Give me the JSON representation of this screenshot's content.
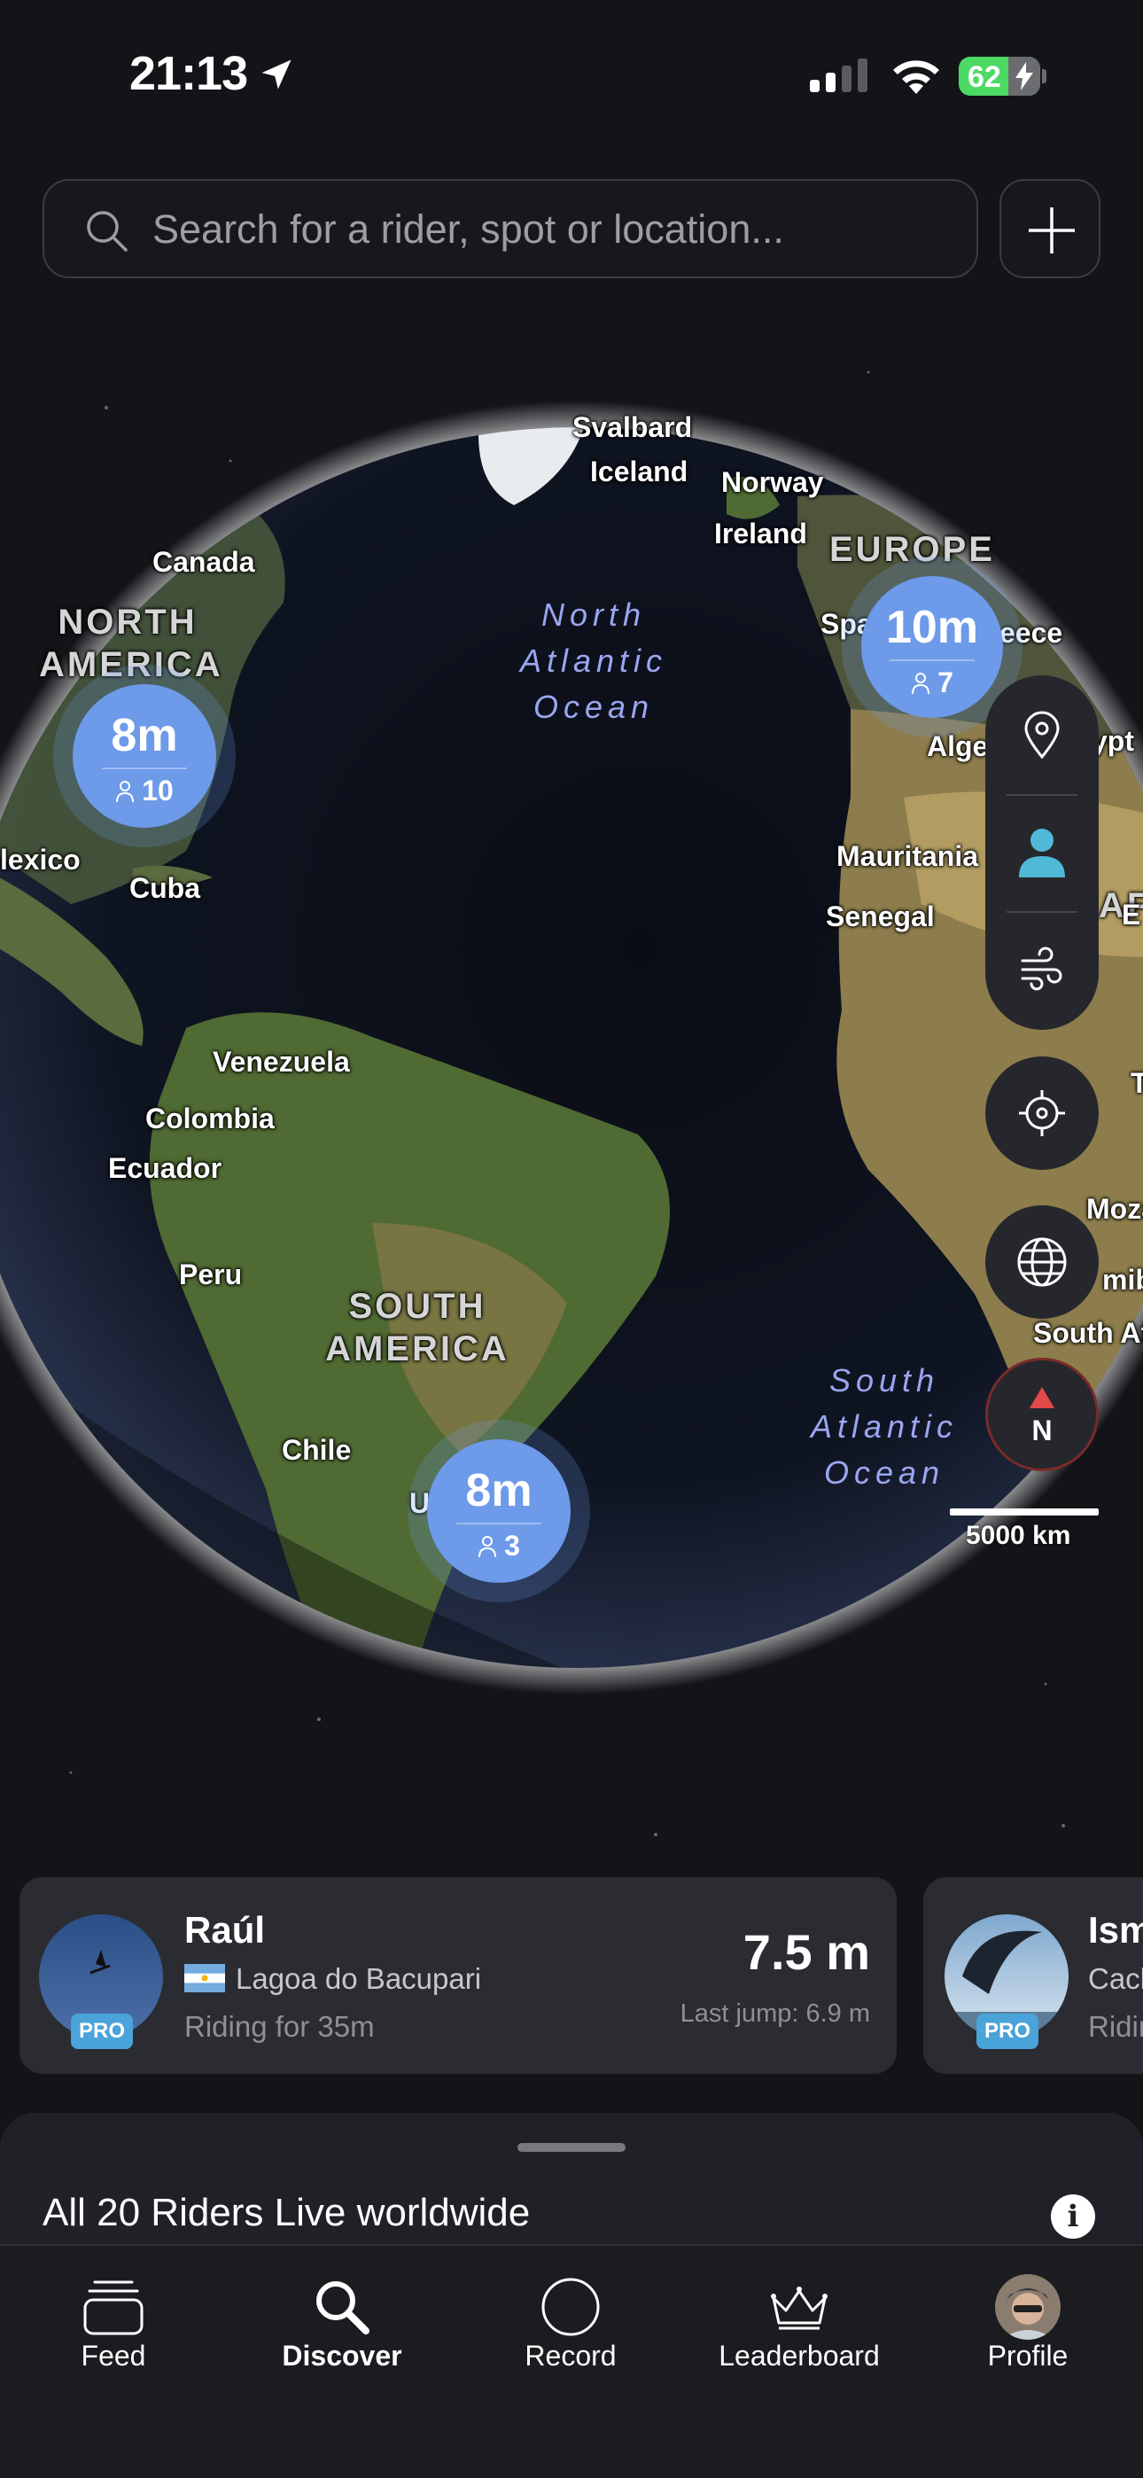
{
  "status_bar": {
    "time": "21:13",
    "battery": "62"
  },
  "search": {
    "placeholder": "Search for a rider, spot or location..."
  },
  "map": {
    "countries": [
      "Svalbard",
      "Iceland",
      "Norway",
      "Ireland",
      "Canada",
      "Cuba",
      "Mexico",
      "Spain",
      "Greece",
      "Algeria",
      "Egypt",
      "Mauritania",
      "Senegal",
      "Venezuela",
      "Colombia",
      "Ecuador",
      "Peru",
      "Chile",
      "Uruguay",
      "Mozambique",
      "Namibia",
      "South Africa"
    ],
    "continents": [
      "NORTH AMERICA",
      "EUROPE",
      "SOUTH AMERICA",
      "AFRICA"
    ],
    "oceans": [
      "North Atlantic Ocean",
      "South Atlantic Ocean"
    ],
    "clusters": [
      {
        "height": "8m",
        "count": "10"
      },
      {
        "height": "10m",
        "count": "7"
      },
      {
        "height": "8m",
        "count": "3"
      }
    ],
    "scale": "5000 km",
    "compass_label": "N"
  },
  "riders": [
    {
      "name": "Raúl",
      "spot": "Lagoa do Bacupari",
      "duration": "Riding for 35m",
      "height": "7.5 m",
      "last_jump": "Last jump: 6.9 m",
      "badge": "PRO"
    },
    {
      "name": "Ism",
      "spot": "Cach",
      "duration": "Ridir",
      "badge": "PRO"
    }
  ],
  "sheet": {
    "title": "All 20 Riders Live worldwide",
    "info_icon": "i"
  },
  "tabs": [
    {
      "label": "Feed",
      "icon": "stack-icon"
    },
    {
      "label": "Discover",
      "icon": "search-icon",
      "active": true
    },
    {
      "label": "Record",
      "icon": "circle-icon"
    },
    {
      "label": "Leaderboard",
      "icon": "crown-icon"
    },
    {
      "label": "Profile",
      "icon": "avatar"
    }
  ],
  "colors": {
    "cluster": "#6d9ae9",
    "pro_badge": "#4aa3d9",
    "accent": "#4fb9d6",
    "compass_red": "#e24a4a"
  }
}
